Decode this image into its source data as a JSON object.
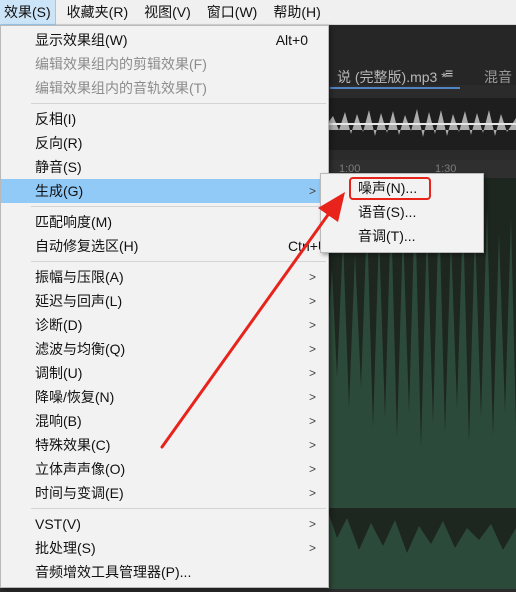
{
  "menubar": {
    "effects": "效果(S)",
    "favorites": "收藏夹(R)",
    "view": "视图(V)",
    "window": "窗口(W)",
    "help": "帮助(H)"
  },
  "editor": {
    "file_tab_title": "说 (完整版).mp3 *",
    "tab_menu_icon": "≡",
    "next_tab": "混音",
    "ruler": [
      "1:00",
      "1:30"
    ]
  },
  "effects_menu": {
    "show_rack": {
      "label": "显示效果组(W)",
      "shortcut": "Alt+0"
    },
    "edit_clip_rack": {
      "label": "编辑效果组内的剪辑效果(F)"
    },
    "edit_track_rack": {
      "label": "编辑效果组内的音轨效果(T)"
    },
    "invert": {
      "label": "反相(I)"
    },
    "reverse": {
      "label": "反向(R)"
    },
    "silence": {
      "label": "静音(S)"
    },
    "generate": {
      "label": "生成(G)"
    },
    "match_loudness": {
      "label": "匹配响度(M)"
    },
    "auto_heal": {
      "label": "自动修复选区(H)",
      "shortcut": "Ctrl+U"
    },
    "amplitude": {
      "label": "振幅与压限(A)"
    },
    "delay": {
      "label": "延迟与回声(L)"
    },
    "diagnostics": {
      "label": "诊断(D)"
    },
    "filter_eq": {
      "label": "滤波与均衡(Q)"
    },
    "modulation": {
      "label": "调制(U)"
    },
    "noise_reduction": {
      "label": "降噪/恢复(N)"
    },
    "reverb": {
      "label": "混响(B)"
    },
    "special": {
      "label": "特殊效果(C)"
    },
    "stereo": {
      "label": "立体声声像(O)"
    },
    "time_pitch": {
      "label": "时间与变调(E)"
    },
    "vst": {
      "label": "VST(V)"
    },
    "batch": {
      "label": "批处理(S)"
    },
    "plugin_manager": {
      "label": "音频增效工具管理器(P)..."
    }
  },
  "generate_submenu": {
    "noise": "噪声(N)...",
    "speech": "语音(S)...",
    "tones": "音调(T)..."
  },
  "colors": {
    "highlight": "#91c9f7",
    "annotation_red": "#e8231c",
    "waveform": "#2c4a39"
  }
}
